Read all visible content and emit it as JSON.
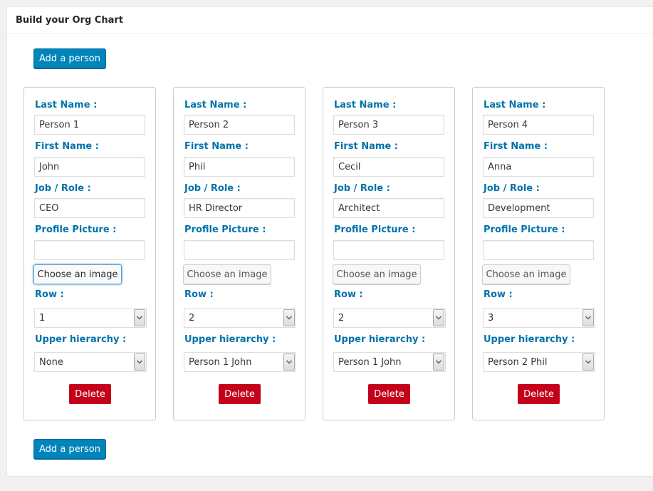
{
  "header": {
    "title": "Build your Org Chart"
  },
  "add_button_label": "Add a person",
  "labels": {
    "last_name": "Last Name :",
    "first_name": "First Name :",
    "job_role": "Job / Role :",
    "profile_picture": "Profile Picture :",
    "choose_image": "Choose an image",
    "row": "Row :",
    "upper_hierarchy": "Upper hierarchy :",
    "delete": "Delete"
  },
  "colors": {
    "accent_blue": "#0085ba",
    "label_blue": "#0073aa",
    "delete_red": "#c4001a"
  },
  "persons": [
    {
      "last_name": "Person 1",
      "first_name": "John",
      "job": "CEO",
      "picture": "",
      "row": "1",
      "upper": "None"
    },
    {
      "last_name": "Person 2",
      "first_name": "Phil",
      "job": "HR Director",
      "picture": "",
      "row": "2",
      "upper": "Person 1 John"
    },
    {
      "last_name": "Person 3",
      "first_name": "Cecil",
      "job": "Architect",
      "picture": "",
      "row": "2",
      "upper": "Person 1 John"
    },
    {
      "last_name": "Person 4",
      "first_name": "Anna",
      "job": "Development",
      "picture": "",
      "row": "3",
      "upper": "Person 2 Phil"
    }
  ]
}
